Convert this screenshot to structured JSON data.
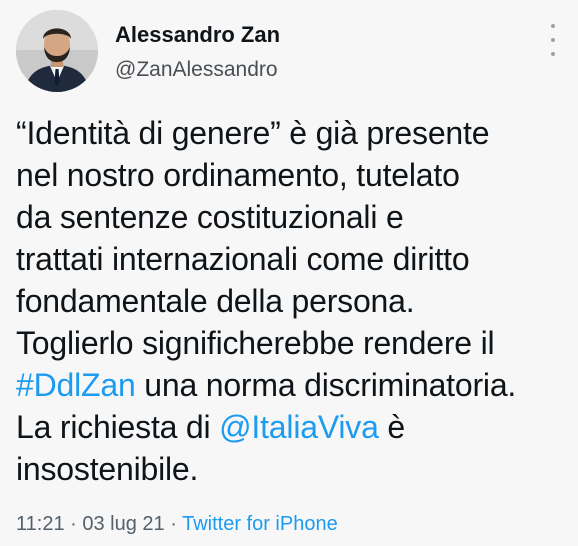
{
  "user": {
    "display_name": "Alessandro Zan",
    "handle": "@ZanAlessandro",
    "avatar_icon": "avatar-icon"
  },
  "tweet": {
    "line_1": "“Identità di genere” è già presente",
    "line_2": "nel nostro ordinamento, tutelato",
    "line_3": "da sentenze costituzionali e",
    "line_4": "trattati internazionali come diritto",
    "line_5": "fondamentale della persona.",
    "line_6": "Toglierlo significherebbe rendere il",
    "hashtag": "#DdlZan",
    "line_7_rest": " una norma discriminatoria.",
    "line_8_start": "La richiesta di ",
    "mention": "@ItaliaViva",
    "line_8_end": " è",
    "line_9": "insostenibile."
  },
  "meta": {
    "time": "11:21",
    "separator_1": " · ",
    "date": "03 lug 21",
    "separator_2": " · ",
    "source": "Twitter for iPhone"
  },
  "colors": {
    "link": "#1d9bf0",
    "text": "#0f1419",
    "secondary": "#55606b",
    "background": "#f7f7f7"
  }
}
